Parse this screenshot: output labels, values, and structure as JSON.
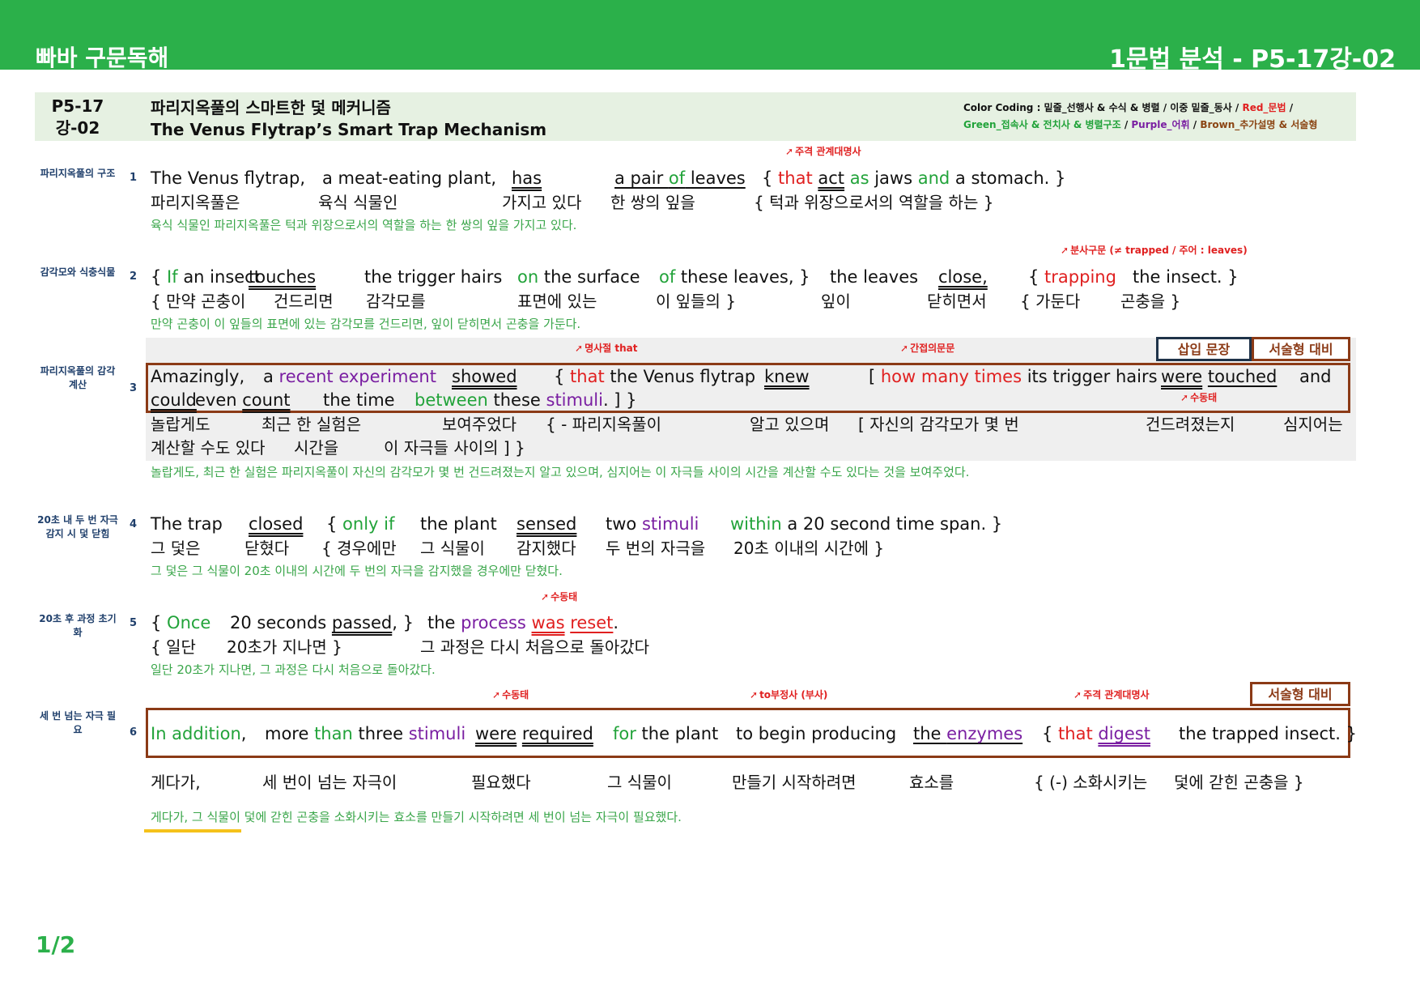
{
  "topbar": {
    "brand": "빠바 구문독해",
    "title": "1문법 분석 - P5-17강-02"
  },
  "header": {
    "code": "P5-17강-02",
    "title_ko": "파리지옥풀의 스마트한 덫 메커니즘",
    "title_en": "The Venus Flytrap’s Smart Trap Mechanism",
    "color_coding": {
      "part1": "Color Coding : 밑줄_선행사 & 수식 & 병렬 / 이중 밑줄_동사 / ",
      "red": "Red_문법",
      "part1_end": " /",
      "green": "Green_접속사 & 전치사 & 병렬구조",
      "sep1": " / ",
      "purple": "Purple_어휘",
      "sep2": " / ",
      "brown": "Brown_추가설명 & 서술형"
    }
  },
  "sentences": [
    {
      "num": "1",
      "side": "파리지옥풀의 구조",
      "en": [
        "The Venus flytrap,",
        "a meat-eating plant,",
        "has",
        "a pair ",
        "of",
        " leaves",
        "{ ",
        "that",
        " ",
        "act",
        " ",
        "as",
        " jaws ",
        "and",
        " a stomach. }"
      ],
      "ko": [
        "파리지옥풀은",
        "육식 식물인",
        "가지고 있다",
        "한 쌍의 잎을",
        "{ 턱과 위장으로서의 역할을 하는 }"
      ],
      "translation": "육식 식물인 파리지옥풀은 턱과 위장으로서의 역할을 하는 한 쌍의 잎을 가지고 있다.",
      "annotations": [
        "주격 관계대명사"
      ]
    },
    {
      "num": "2",
      "side": "감각모와 식충식물",
      "en": [
        "{ ",
        "If",
        " an insect",
        "touches",
        "the trigger hairs",
        "on",
        " the surface",
        "of",
        " these leaves, }",
        "the leaves",
        "close,",
        "{ ",
        "trapping",
        "the insect. }"
      ],
      "ko": [
        "{ 만약 곤충이",
        "건드리면",
        "감각모를",
        "표면에 있는",
        "이 잎들의 }",
        "잎이",
        "닫히면서",
        "{ 가둔다",
        "곤충을 }"
      ],
      "translation": "만약 곤충이 이 잎들의 표면에 있는 감각모를 건드리면, 잎이 닫히면서 곤충을 가둔다.",
      "annotations": [
        "분사구문 (≠ trapped / 주어 : leaves)"
      ]
    },
    {
      "num": "3",
      "side": "파리지옥풀의 감각 계산",
      "en": [
        "Amazingly,",
        "a ",
        "recent experiment",
        "showed",
        "{ ",
        "that",
        " the Venus flytrap",
        "knew",
        "[ ",
        "how many times",
        " its trigger hairs",
        "were",
        " ",
        "touched",
        "and",
        "could",
        " even ",
        "count",
        "the time",
        "between",
        " these ",
        "stimuli",
        ". ] }"
      ],
      "ko": [
        "놀랍게도",
        "최근 한 실험은",
        "보여주었다",
        "{ - 파리지옥풀이",
        "알고 있으며",
        "[ 자신의 감각모가 몇 번",
        "건드려졌는지",
        "심지어는",
        "계산할 수도 있다",
        "시간을",
        "이 자극들 사이의 ] }"
      ],
      "translation": "놀랍게도, 최근 한 실험은 파리지옥풀이 자신의 감각모가 몇 번 건드려졌는지 알고 있으며, 심지어는 이 자극들 사이의 시간을 계산할 수도 있다는 것을 보여주었다.",
      "annotations": [
        "명사절 that",
        "간접의문문",
        "수동태"
      ],
      "tags": [
        "삽입 문장",
        "서술형 대비"
      ]
    },
    {
      "num": "4",
      "side": "20초 내 두 번 자극 감지 시 덫 닫힘",
      "en": [
        "The trap",
        "closed",
        "{ ",
        "only if",
        "the plant",
        "sensed",
        "two ",
        "stimuli",
        "within",
        " a 20 second time span. }"
      ],
      "ko": [
        "그 덫은",
        "닫혔다",
        "{ 경우에만",
        "그 식물이",
        "감지했다",
        "두 번의 자극을",
        "20초 이내의 시간에 }"
      ],
      "translation": "그 덫은 그 식물이 20초 이내의 시간에 두 번의 자극을 감지했을 경우에만 닫혔다."
    },
    {
      "num": "5",
      "side": "20초 후 과정 초기화",
      "en": [
        "{ ",
        "Once",
        "20 seconds ",
        "passed",
        ", }",
        "the ",
        "process",
        " ",
        "was",
        " ",
        "reset",
        "."
      ],
      "ko": [
        "{ 일단",
        "20초가 지나면 }",
        "그 과정은 다시 처음으로 돌아갔다"
      ],
      "translation": "일단 20초가 지나면, 그 과정은 다시 처음으로 돌아갔다.",
      "annotations": [
        "수동태"
      ]
    },
    {
      "num": "6",
      "side": "세 번 넘는 자극 필요",
      "en": [
        "In addition",
        ",",
        "more ",
        "than",
        " three ",
        "stimuli",
        "were",
        " ",
        "required",
        "for",
        " the plant",
        "to begin producing",
        "the ",
        "enzymes",
        "{ ",
        "that",
        " ",
        "digest",
        "the trapped insect. }"
      ],
      "ko": [
        "게다가,",
        "세 번이 넘는 자극이",
        "필요했다",
        "그 식물이",
        "만들기 시작하려면",
        "효소를",
        "{ (-) 소화시키는",
        "덫에 갇힌 곤충을 }"
      ],
      "translation": "게다가, 그 식물이 덫에 갇힌 곤충을 소화시키는 효소를 만들기 시작하려면 세 번이 넘는 자극이 필요했다.",
      "annotations": [
        "수동태",
        "to부정사 (부사)",
        "주격 관계대명사"
      ],
      "tags": [
        "서술형 대비"
      ]
    }
  ],
  "page": "1/2",
  "colors": {
    "accent": "#2bb04a",
    "red": "#e02020",
    "green": "#22a33a",
    "purple": "#7a1fa2",
    "brown": "#8b3a16"
  },
  "icons": {
    "annotation_arrow": "curved-arrow-icon"
  }
}
